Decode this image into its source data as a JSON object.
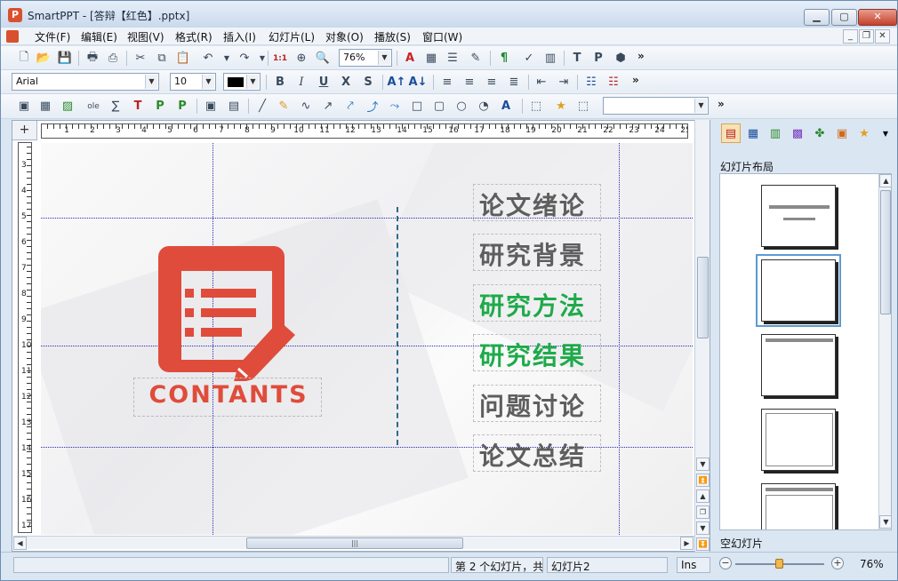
{
  "window": {
    "app_icon": "P",
    "title": "SmartPPT - [答辩【红色】.pptx]",
    "minimize": "▁",
    "maximize": "▢",
    "close": "✕"
  },
  "menu": {
    "items": [
      "文件(F)",
      "编辑(E)",
      "视图(V)",
      "格式(R)",
      "插入(I)",
      "幻灯片(L)",
      "对象(O)",
      "播放(S)",
      "窗口(W)"
    ],
    "mdi_minimize": "_",
    "mdi_restore": "❐",
    "mdi_close": "✕"
  },
  "toolbar1": {
    "zoom_value": "76%",
    "more": "»"
  },
  "toolbar2": {
    "font_name": "Arial",
    "font_size": "10",
    "more": "»",
    "bold": "B",
    "italic": "I",
    "underline": "U",
    "strike": "X",
    "shadow": "S",
    "font_color": "#000000"
  },
  "toolbar3": {
    "style_value": "",
    "more": "»"
  },
  "ruler": {
    "corner": "+",
    "h_numbers": [
      "1",
      "2",
      "3",
      "4",
      "5",
      "6",
      "7",
      "8",
      "9",
      "10",
      "11",
      "12",
      "13",
      "14",
      "15",
      "16",
      "17",
      "18",
      "19",
      "20",
      "21",
      "22",
      "23",
      "24",
      "25"
    ],
    "v_numbers": [
      "3",
      "4",
      "5",
      "6",
      "7",
      "8",
      "9",
      "10",
      "11",
      "12",
      "13",
      "14",
      "15",
      "16",
      "17"
    ]
  },
  "slide": {
    "contants_label": "CONTANTS",
    "accent_color": "#e04c3b",
    "toc": [
      {
        "text": "论文绪论",
        "highlight": false
      },
      {
        "text": "研究背景",
        "highlight": false
      },
      {
        "text": "研究方法",
        "highlight": true
      },
      {
        "text": "研究结果",
        "highlight": true
      },
      {
        "text": "问题讨论",
        "highlight": false
      },
      {
        "text": "论文总结",
        "highlight": false
      }
    ],
    "green_color": "#1faa4a",
    "gray_color": "#5e5e5e"
  },
  "panel": {
    "title": "幻灯片布局",
    "current_layout": "空幻灯片"
  },
  "status": {
    "slide_info": "第 2 个幻灯片，共",
    "slide_name": "幻灯片2",
    "mode": "Ins",
    "zoom": "76%",
    "zoom_level": 0.5,
    "zoom_minus": "−",
    "zoom_plus": "+"
  }
}
